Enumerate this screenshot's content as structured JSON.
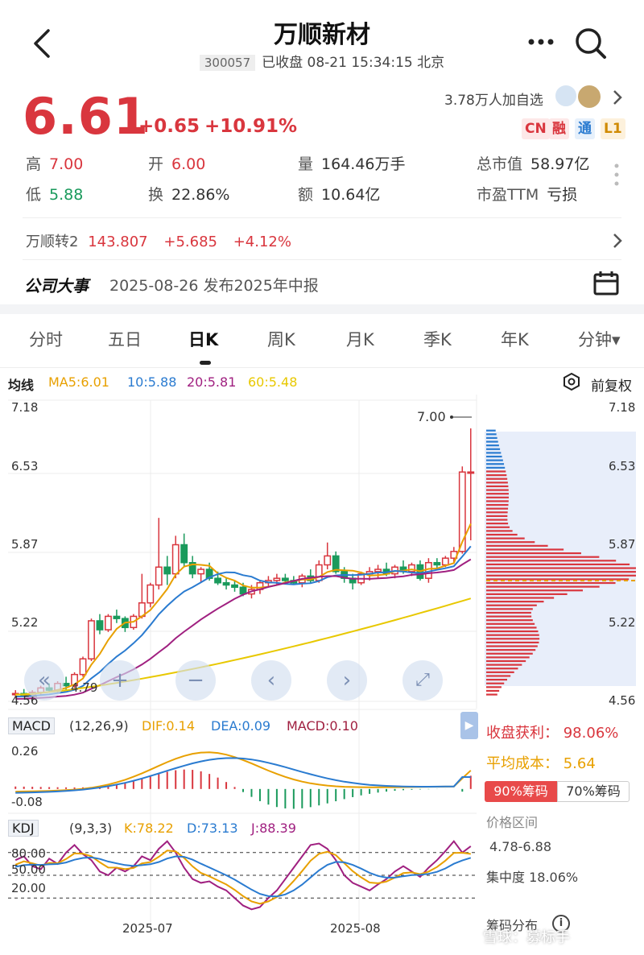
{
  "header": {
    "title": "万顺新材",
    "code": "300057",
    "status": "已收盘 08-21 15:34:15 北京"
  },
  "quote": {
    "price": "6.61",
    "change": "+0.65",
    "change_pct": "+10.91%",
    "watchers": "3.78万人加自选",
    "tags": [
      "CN",
      "融",
      "通",
      "L1"
    ],
    "high_label": "高",
    "high": "7.00",
    "low_label": "低",
    "low": "5.88",
    "open_label": "开",
    "open": "6.00",
    "turnover_label": "换",
    "turnover": "22.86%",
    "volume_label": "量",
    "volume": "164.46万手",
    "amount_label": "额",
    "amount": "10.64亿",
    "mktcap_label": "总市值",
    "mktcap": "58.97亿",
    "pe_label": "市盈TTM",
    "pe": "亏损"
  },
  "bond": {
    "name": "万顺转2",
    "price": "143.807",
    "change": "+5.685",
    "change_pct": "+4.12%"
  },
  "event": {
    "label": "公司大事",
    "text": "2025-08-26 发布2025年中报"
  },
  "tabs": [
    "分时",
    "五日",
    "日K",
    "周K",
    "月K",
    "季K",
    "年K",
    "分钟▾"
  ],
  "active_tab": "日K",
  "ma_legend": {
    "label": "均线",
    "ma5": "MA5:6.01",
    "ma10": "10:5.88",
    "ma20": "20:5.81",
    "ma60": "60:5.48",
    "adjust": "前复权"
  },
  "chart_data": [
    {
      "type": "candlestick",
      "title": "日K",
      "y_ticks": [
        "7.18",
        "6.53",
        "5.87",
        "5.22",
        "4.56"
      ],
      "ylim": [
        4.56,
        7.18
      ],
      "x_ticks": [
        "2025-07",
        "2025-08"
      ],
      "annotations": [
        "7.00",
        "4.79"
      ],
      "candles": [
        [
          4.62,
          4.66,
          4.59,
          4.63
        ],
        [
          4.63,
          4.67,
          4.6,
          4.61
        ],
        [
          4.61,
          4.66,
          4.58,
          4.64
        ],
        [
          4.64,
          4.7,
          4.62,
          4.68
        ],
        [
          4.68,
          4.72,
          4.64,
          4.66
        ],
        [
          4.66,
          4.74,
          4.64,
          4.72
        ],
        [
          4.72,
          4.78,
          4.66,
          4.7
        ],
        [
          4.7,
          4.82,
          4.68,
          4.8
        ],
        [
          4.8,
          4.96,
          4.78,
          4.94
        ],
        [
          4.94,
          5.3,
          4.92,
          5.28
        ],
        [
          5.28,
          5.34,
          5.16,
          5.2
        ],
        [
          5.2,
          5.34,
          5.18,
          5.32
        ],
        [
          5.32,
          5.38,
          5.26,
          5.3
        ],
        [
          5.3,
          5.32,
          5.18,
          5.22
        ],
        [
          5.22,
          5.34,
          5.2,
          5.32
        ],
        [
          5.32,
          5.7,
          5.3,
          5.44
        ],
        [
          5.44,
          5.62,
          5.4,
          5.6
        ],
        [
          5.6,
          6.2,
          5.56,
          5.76
        ],
        [
          5.76,
          5.86,
          5.6,
          5.7
        ],
        [
          5.7,
          6.04,
          5.66,
          5.96
        ],
        [
          5.96,
          6.06,
          5.76,
          5.8
        ],
        [
          5.8,
          5.86,
          5.66,
          5.7
        ],
        [
          5.7,
          5.76,
          5.62,
          5.74
        ],
        [
          5.74,
          5.8,
          5.64,
          5.66
        ],
        [
          5.66,
          5.72,
          5.6,
          5.62
        ],
        [
          5.62,
          5.66,
          5.56,
          5.6
        ],
        [
          5.6,
          5.64,
          5.54,
          5.58
        ],
        [
          5.58,
          5.62,
          5.5,
          5.52
        ],
        [
          5.52,
          5.6,
          5.48,
          5.56
        ],
        [
          5.56,
          5.64,
          5.52,
          5.62
        ],
        [
          5.62,
          5.68,
          5.58,
          5.64
        ],
        [
          5.64,
          5.7,
          5.6,
          5.66
        ],
        [
          5.66,
          5.7,
          5.62,
          5.64
        ],
        [
          5.64,
          5.68,
          5.6,
          5.62
        ],
        [
          5.62,
          5.7,
          5.58,
          5.68
        ],
        [
          5.68,
          5.74,
          5.62,
          5.64
        ],
        [
          5.64,
          5.82,
          5.62,
          5.78
        ],
        [
          5.78,
          5.98,
          5.74,
          5.86
        ],
        [
          5.86,
          5.9,
          5.7,
          5.72
        ],
        [
          5.72,
          5.76,
          5.62,
          5.66
        ],
        [
          5.66,
          5.7,
          5.56,
          5.62
        ],
        [
          5.62,
          5.72,
          5.6,
          5.7
        ],
        [
          5.7,
          5.76,
          5.64,
          5.72
        ],
        [
          5.72,
          5.78,
          5.66,
          5.74
        ],
        [
          5.74,
          5.8,
          5.68,
          5.7
        ],
        [
          5.7,
          5.78,
          5.66,
          5.76
        ],
        [
          5.76,
          5.82,
          5.7,
          5.72
        ],
        [
          5.72,
          5.8,
          5.68,
          5.78
        ],
        [
          5.78,
          5.82,
          5.64,
          5.66
        ],
        [
          5.66,
          5.84,
          5.62,
          5.8
        ],
        [
          5.8,
          5.84,
          5.74,
          5.78
        ],
        [
          5.78,
          5.86,
          5.76,
          5.84
        ],
        [
          5.84,
          5.94,
          5.8,
          5.9
        ],
        [
          5.9,
          6.66,
          5.88,
          6.61
        ],
        [
          6.61,
          7.0,
          6.0,
          6.61
        ]
      ],
      "series": [
        {
          "name": "MA5",
          "color": "#e8a000",
          "last": 6.01
        },
        {
          "name": "10",
          "color": "#2a7bd0",
          "last": 5.88
        },
        {
          "name": "20",
          "color": "#a02080",
          "last": 5.81
        },
        {
          "name": "60",
          "color": "#e8c800",
          "last": 5.48
        }
      ]
    },
    {
      "type": "bar",
      "title": "MACD",
      "params": "(12,26,9)",
      "dif": "DIF:0.14",
      "dea": "DEA:0.09",
      "macd": "MACD:0.10",
      "y_ticks": [
        "0.26",
        "-0.08"
      ],
      "ylim": [
        -0.08,
        0.26
      ]
    },
    {
      "type": "line",
      "title": "KDJ",
      "params": "(9,3,3)",
      "k": "K:78.22",
      "d": "D:73.13",
      "j": "J:88.39",
      "y_ticks": [
        "80.00",
        "50.00",
        "20.00"
      ],
      "ylim": [
        0,
        100
      ]
    }
  ],
  "chips": {
    "profit_label": "收盘获利：",
    "profit": "98.06%",
    "cost_label": "平均成本：",
    "cost": "5.64",
    "btn90": "90%筹码",
    "btn70": "70%筹码",
    "range_label": "价格区间",
    "range": "4.78-6.88",
    "conc_label": "集中度",
    "conc": "18.06%",
    "dist_label": "筹码分布"
  },
  "watermark": "雪球：募标手",
  "colors": {
    "up": "#d9363e",
    "down": "#1a9a5c",
    "accent": "#2a7bd0"
  }
}
